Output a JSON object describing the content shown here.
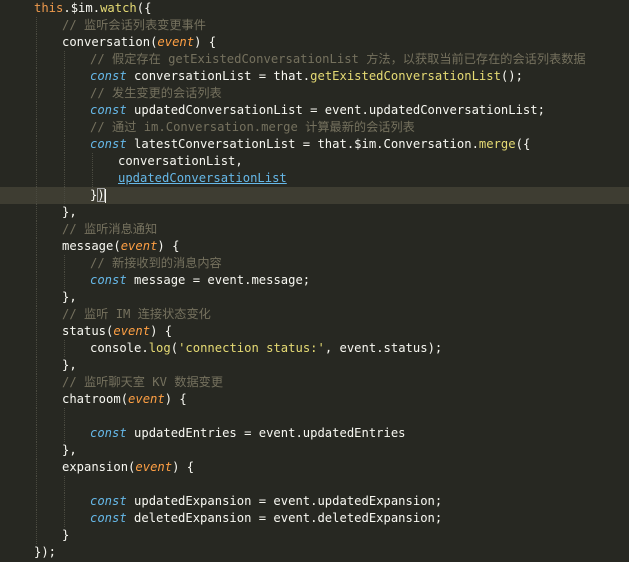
{
  "editor": {
    "lines": [
      [
        {
          "t": "this",
          "c": "kw"
        },
        {
          "t": ".",
          "c": "plain"
        },
        {
          "t": "$im",
          "c": "plain"
        },
        {
          "t": ".",
          "c": "plain"
        },
        {
          "t": "watch",
          "c": "call"
        },
        {
          "t": "({",
          "c": "plain"
        }
      ],
      [
        {
          "t": "// 监听会话列表变更事件",
          "c": "comment"
        }
      ],
      [
        {
          "t": "conversation",
          "c": "fn"
        },
        {
          "t": "(",
          "c": "plain"
        },
        {
          "t": "event",
          "c": "param"
        },
        {
          "t": ") {",
          "c": "plain"
        }
      ],
      [
        {
          "t": "// 假定存在 getExistedConversationList 方法，以获取当前已存在的会话列表数据",
          "c": "comment"
        }
      ],
      [
        {
          "t": "const",
          "c": "storage"
        },
        {
          "t": " conversationList = that",
          "c": "plain"
        },
        {
          "t": ".",
          "c": "plain"
        },
        {
          "t": "getExistedConversationList",
          "c": "call"
        },
        {
          "t": "();",
          "c": "plain"
        }
      ],
      [
        {
          "t": "// 发生变更的会话列表",
          "c": "comment"
        }
      ],
      [
        {
          "t": "const",
          "c": "storage"
        },
        {
          "t": " updatedConversationList = event",
          "c": "plain"
        },
        {
          "t": ".",
          "c": "plain"
        },
        {
          "t": "updatedConversationList;",
          "c": "plain"
        }
      ],
      [
        {
          "t": "// 通过 im.Conversation.merge 计算最新的会话列表",
          "c": "comment"
        }
      ],
      [
        {
          "t": "const",
          "c": "storage"
        },
        {
          "t": " latestConversationList = that",
          "c": "plain"
        },
        {
          "t": ".",
          "c": "plain"
        },
        {
          "t": "$im",
          "c": "plain"
        },
        {
          "t": ".",
          "c": "plain"
        },
        {
          "t": "Conversation",
          "c": "plain"
        },
        {
          "t": ".",
          "c": "plain"
        },
        {
          "t": "merge",
          "c": "call"
        },
        {
          "t": "({",
          "c": "plain"
        }
      ],
      [
        {
          "t": "conversationList,",
          "c": "plain"
        }
      ],
      [
        {
          "t": "updatedConversationList",
          "c": "link"
        }
      ],
      [
        {
          "t": "}",
          "c": "plain"
        },
        {
          "t": ")",
          "c": "bracket"
        }
      ],
      [
        {
          "t": "},",
          "c": "plain"
        }
      ],
      [
        {
          "t": "// 监听消息通知",
          "c": "comment"
        }
      ],
      [
        {
          "t": "message",
          "c": "fn"
        },
        {
          "t": "(",
          "c": "plain"
        },
        {
          "t": "event",
          "c": "param"
        },
        {
          "t": ") {",
          "c": "plain"
        }
      ],
      [
        {
          "t": "// 新接收到的消息内容",
          "c": "comment"
        }
      ],
      [
        {
          "t": "const",
          "c": "storage"
        },
        {
          "t": " message = event",
          "c": "plain"
        },
        {
          "t": ".",
          "c": "plain"
        },
        {
          "t": "message;",
          "c": "plain"
        }
      ],
      [
        {
          "t": "},",
          "c": "plain"
        }
      ],
      [
        {
          "t": "// 监听 IM 连接状态变化",
          "c": "comment"
        }
      ],
      [
        {
          "t": "status",
          "c": "fn"
        },
        {
          "t": "(",
          "c": "plain"
        },
        {
          "t": "event",
          "c": "param"
        },
        {
          "t": ") {",
          "c": "plain"
        }
      ],
      [
        {
          "t": "console",
          "c": "plain"
        },
        {
          "t": ".",
          "c": "plain"
        },
        {
          "t": "log",
          "c": "call"
        },
        {
          "t": "(",
          "c": "plain"
        },
        {
          "t": "'connection status:'",
          "c": "string"
        },
        {
          "t": ", event",
          "c": "plain"
        },
        {
          "t": ".",
          "c": "plain"
        },
        {
          "t": "status);",
          "c": "plain"
        }
      ],
      [
        {
          "t": "},",
          "c": "plain"
        }
      ],
      [
        {
          "t": "// 监听聊天室 KV 数据变更",
          "c": "comment"
        }
      ],
      [
        {
          "t": "chatroom",
          "c": "fn"
        },
        {
          "t": "(",
          "c": "plain"
        },
        {
          "t": "event",
          "c": "param"
        },
        {
          "t": ") {",
          "c": "plain"
        }
      ],
      [],
      [
        {
          "t": "const",
          "c": "storage"
        },
        {
          "t": " updatedEntries = event",
          "c": "plain"
        },
        {
          "t": ".",
          "c": "plain"
        },
        {
          "t": "updatedEntries",
          "c": "plain"
        }
      ],
      [
        {
          "t": "},",
          "c": "plain"
        }
      ],
      [
        {
          "t": "expansion",
          "c": "fn"
        },
        {
          "t": "(",
          "c": "plain"
        },
        {
          "t": "event",
          "c": "param"
        },
        {
          "t": ") {",
          "c": "plain"
        }
      ],
      [],
      [
        {
          "t": "const",
          "c": "storage"
        },
        {
          "t": " updatedExpansion = event",
          "c": "plain"
        },
        {
          "t": ".",
          "c": "plain"
        },
        {
          "t": "updatedExpansion;",
          "c": "plain"
        }
      ],
      [
        {
          "t": "const",
          "c": "storage"
        },
        {
          "t": " deletedExpansion = event",
          "c": "plain"
        },
        {
          "t": ".",
          "c": "plain"
        },
        {
          "t": "deletedExpansion;",
          "c": "plain"
        }
      ],
      [
        {
          "t": "}",
          "c": "plain"
        }
      ],
      [
        {
          "t": "});",
          "c": "plain"
        }
      ]
    ],
    "colors": {
      "background": "#272822",
      "current_line": "#3e3d32",
      "keyword": "#ee9a4d",
      "storage": "#66b8e8",
      "comment": "#75715e",
      "string": "#e6db74",
      "param": "#ffa044",
      "text": "#f8f8f2"
    }
  }
}
